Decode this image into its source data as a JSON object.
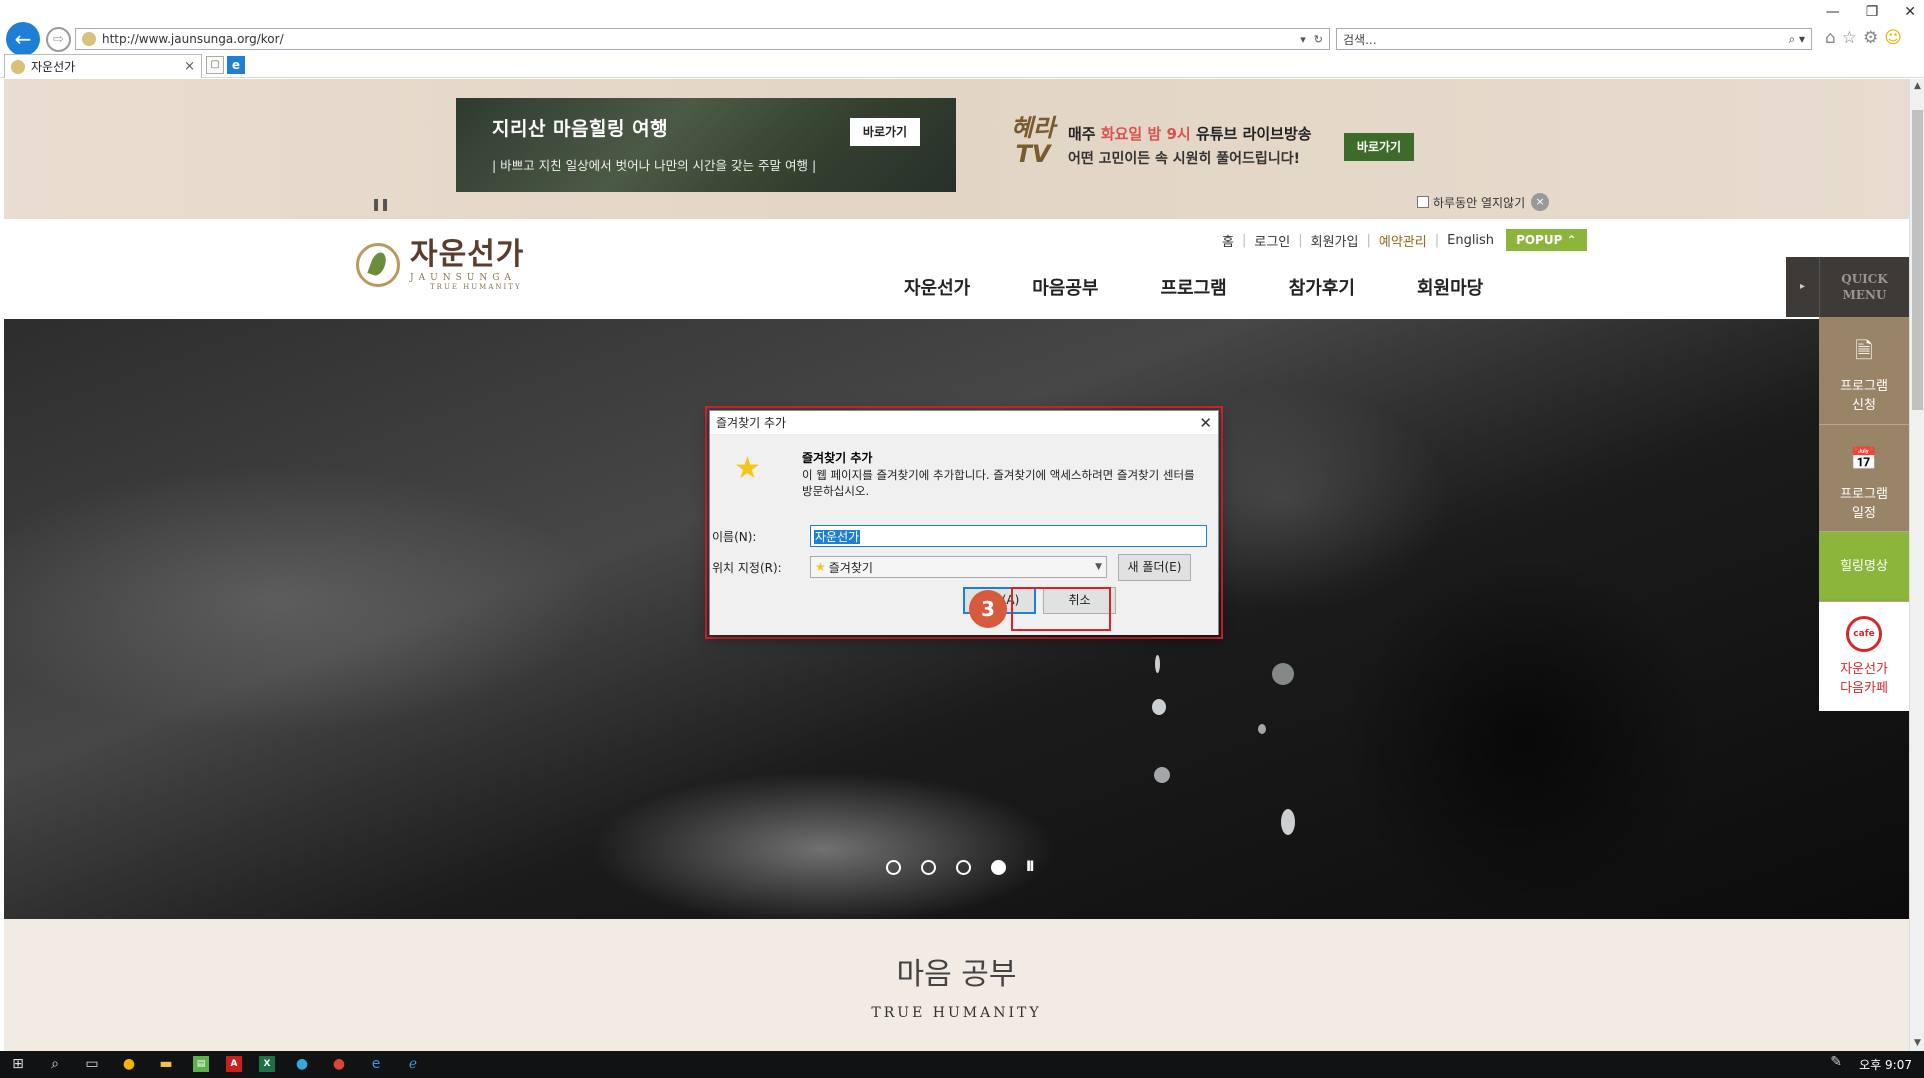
{
  "browser": {
    "url": "http://www.jaunsunga.org/kor/",
    "search_placeholder": "검색...",
    "tab_title": "자운선가",
    "icons": [
      "back-icon",
      "forward-icon",
      "refresh-icon",
      "search-icon",
      "home-icon",
      "favorites-icon",
      "settings-icon",
      "smiley-icon"
    ]
  },
  "promo": {
    "left": {
      "title": "지리산 마음힐링 여행",
      "subtitle": "| 바쁘고 지친 일상에서 벗어나 나만의 시간을 갖는 주말 여행 |",
      "button": "바로가기"
    },
    "right": {
      "logo_line1": "혜라",
      "logo_line2": "TV",
      "line1_pre": "매주 ",
      "line1_hl": "화요일 밤 9시",
      "line1_post": " 유튜브 라이브방송",
      "line2": "어떤 고민이든 속 시원히 풀어드립니다!",
      "button": "바로가기"
    },
    "dismiss_label": "하루동안 열지않기",
    "dismiss_close": "×"
  },
  "header": {
    "logo_main": "자운선가",
    "logo_sub": "JAUNSUNGA",
    "logo_sub2": "TRUE HUMANITY",
    "util_nav": [
      "홈",
      "로그인",
      "회원가입",
      "예약관리",
      "English"
    ],
    "popup_label": "POPUP ⌃",
    "main_nav": [
      "자운선가",
      "마음공부",
      "프로그램",
      "참가후기",
      "회원마당"
    ]
  },
  "hero": {
    "slide_count": 4,
    "active_slide": 4,
    "pause_label": "II"
  },
  "section": {
    "title": "마음 공부",
    "subtitle": "TRUE HUMANITY"
  },
  "quick_menu": {
    "arrow": "▸",
    "title_line1": "QUICK",
    "title_line2": "MENU",
    "items": [
      {
        "line1": "프로그램",
        "line2": "신청"
      },
      {
        "line1": "프로그램",
        "line2": "일정"
      },
      {
        "line1": "힐링명상",
        "line2": ""
      },
      {
        "line1": "자운선가",
        "line2": "다음카페",
        "logo": "cafe"
      }
    ]
  },
  "dialog": {
    "title": "즐겨찾기 추가",
    "close": "✕",
    "heading": "즐겨찾기 추가",
    "description": "이 웹 페이지를 즐겨찾기에 추가합니다. 즐겨찾기에 액세스하려면 즐겨찾기 센터를 방문하십시오.",
    "name_label": "이름(N):",
    "name_value": "자운선가",
    "location_label": "위치 지정(R):",
    "location_value": "즐겨찾기",
    "new_folder_button": "새 폴더(E)",
    "add_button": "추가(A)",
    "cancel_button": "취소"
  },
  "annotation": {
    "step": "3",
    "color": "#d8232a"
  },
  "taskbar": {
    "clock": "오후 9:07",
    "apps": [
      "start-icon",
      "search-icon",
      "task-view-icon",
      "chrome-icon",
      "file-explorer-icon",
      "notepad-icon",
      "acrobat-icon",
      "excel-icon",
      "telegram-icon",
      "chrome-icon",
      "edge-icon",
      "ie-icon"
    ]
  }
}
